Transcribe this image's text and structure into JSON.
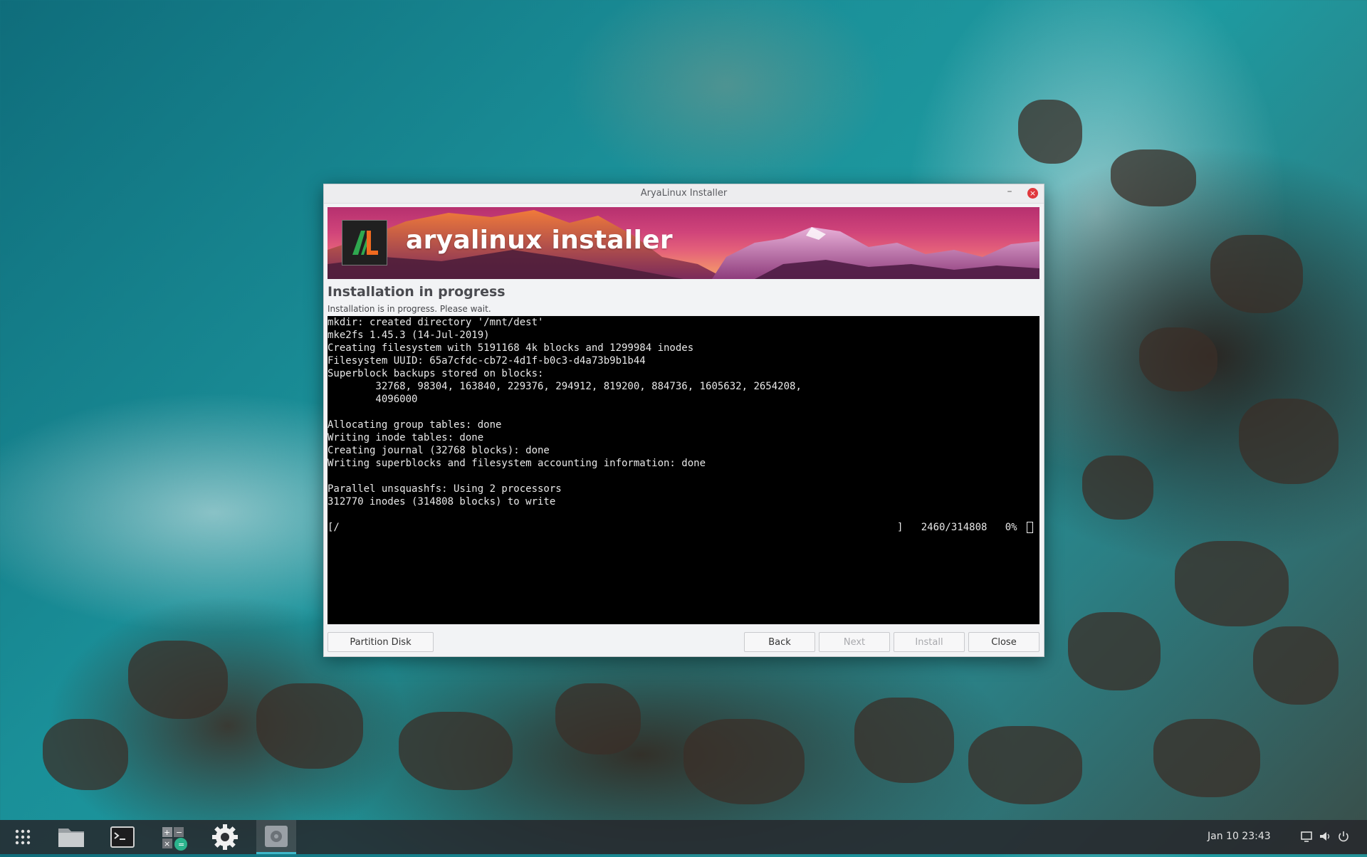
{
  "window": {
    "title": "AryaLinux Installer",
    "minimize_glyph": "–",
    "close_glyph": "×"
  },
  "banner": {
    "logo_icon": "aryalinux-logo-icon",
    "title": "aryalinux installer"
  },
  "page": {
    "heading": "Installation in progress",
    "subheading": "Installation is in progress. Please wait."
  },
  "terminal": {
    "lines": [
      "mkdir: created directory '/mnt/dest'",
      "mke2fs 1.45.3 (14-Jul-2019)",
      "Creating filesystem with 5191168 4k blocks and 1299984 inodes",
      "Filesystem UUID: 65a7cfdc-cb72-4d1f-b0c3-d4a73b9b1b44",
      "Superblock backups stored on blocks:",
      "        32768, 98304, 163840, 229376, 294912, 819200, 884736, 1605632, 2654208,",
      "        4096000",
      "",
      "Allocating group tables: done",
      "Writing inode tables: done",
      "Creating journal (32768 blocks): done",
      "Writing superblocks and filesystem accounting information: done",
      "",
      "Parallel unsquashfs: Using 2 processors",
      "312770 inodes (314808 blocks) to write",
      ""
    ],
    "progress": {
      "left": "[/",
      "right": "]   2460/314808   0%"
    }
  },
  "buttons": {
    "partition": "Partition Disk",
    "back": "Back",
    "next": "Next",
    "install": "Install",
    "close": "Close"
  },
  "taskbar": {
    "apps": [
      {
        "name": "app-grid-icon",
        "active": false
      },
      {
        "name": "file-manager-icon",
        "active": false
      },
      {
        "name": "terminal-icon",
        "active": false
      },
      {
        "name": "calculator-icon",
        "active": false
      },
      {
        "name": "settings-gear-icon",
        "active": false
      },
      {
        "name": "installer-icon",
        "active": true
      }
    ],
    "clock": "Jan 10 23:43",
    "tray": [
      "display-icon",
      "volume-icon",
      "power-icon"
    ]
  },
  "colors": {
    "accent": "#3fb6c8",
    "close_red": "#e0383d",
    "terminal_bg": "#000000"
  }
}
